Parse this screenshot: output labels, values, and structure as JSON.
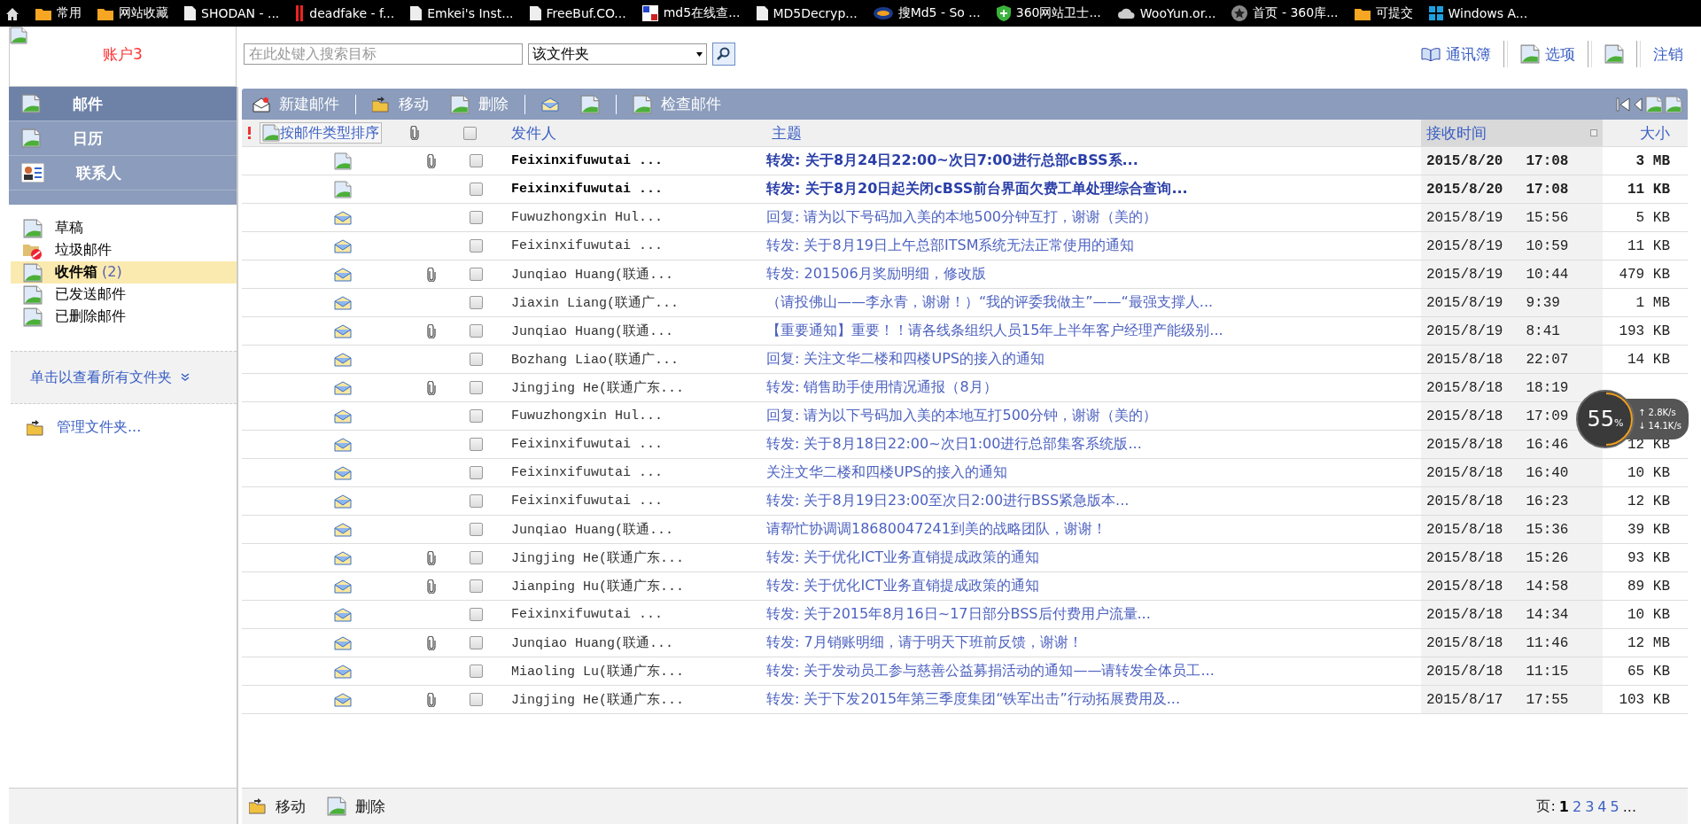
{
  "bookmarks": [
    {
      "kind": "home"
    },
    {
      "label": "常用",
      "kind": "folder"
    },
    {
      "label": "网站收藏",
      "kind": "folder"
    },
    {
      "label": "SHODAN - ...",
      "kind": "page"
    },
    {
      "label": "deadfake - f...",
      "kind": "bars"
    },
    {
      "label": "Emkei's Inst...",
      "kind": "page"
    },
    {
      "label": "FreeBuf.CO...",
      "kind": "page"
    },
    {
      "label": "md5在线查...",
      "kind": "grid"
    },
    {
      "label": "MD5Decryp...",
      "kind": "page"
    },
    {
      "label": "搜Md5 - So ...",
      "kind": "badge"
    },
    {
      "label": "360网站卫士...",
      "kind": "shield"
    },
    {
      "label": "WooYun.or...",
      "kind": "cloud"
    },
    {
      "label": "首页 - 360库...",
      "kind": "star"
    },
    {
      "label": "可提交",
      "kind": "folder"
    },
    {
      "label": "Windows A...",
      "kind": "windows"
    }
  ],
  "account": {
    "name": "账户3"
  },
  "search": {
    "placeholder": "在此处键入搜索目标",
    "scope": "该文件夹"
  },
  "top_links": [
    {
      "label": "通讯簿",
      "kind": "book"
    },
    {
      "label": "选项",
      "kind": "image"
    },
    {
      "kind": "image"
    },
    {
      "label": "注销",
      "kind": "none"
    }
  ],
  "nav": [
    {
      "label": "邮件",
      "selected": true,
      "kind": "image"
    },
    {
      "label": "日历",
      "selected": false,
      "kind": "image"
    },
    {
      "label": "联系人",
      "selected": false,
      "kind": "contact"
    }
  ],
  "folders": [
    {
      "label": "草稿",
      "selected": false,
      "kind": "image"
    },
    {
      "label": "垃圾邮件",
      "selected": false,
      "kind": "junk"
    },
    {
      "label": "收件箱",
      "count": "(2)",
      "selected": true,
      "kind": "image"
    },
    {
      "label": "已发送邮件",
      "selected": false,
      "kind": "image"
    },
    {
      "label": "已删除邮件",
      "selected": false,
      "kind": "image"
    }
  ],
  "all_folders_link": "单击以查看所有文件夹",
  "manage_folders": "管理文件夹...",
  "toolbar": [
    {
      "label": "新建邮件",
      "kind": "new"
    },
    {
      "label": "移动",
      "kind": "move"
    },
    {
      "label": "删除",
      "kind": "image"
    },
    {
      "kind": "envelope"
    },
    {
      "kind": "image"
    },
    {
      "label": "检查邮件",
      "kind": "image"
    }
  ],
  "columns": {
    "select_all_checked": false,
    "sort_by_type": "按邮件类型排序",
    "sender": "发件人",
    "subject": "主题",
    "received": "接收时间",
    "size": "大小"
  },
  "messages": [
    {
      "unread": true,
      "attachment": true,
      "checked": false,
      "sender": "Feixinxifuwutai ...",
      "subject": "转发: 关于8月24日22:00~次日7:00进行总部cBSS系...",
      "date": "2015/8/20",
      "time": "17:08",
      "size": "3 MB"
    },
    {
      "unread": true,
      "attachment": false,
      "checked": false,
      "sender": "Feixinxifuwutai ...",
      "subject": "转发: 关于8月20日起关闭cBSS前台界面欠费工单处理综合查询...",
      "date": "2015/8/20",
      "time": "17:08",
      "size": "11 KB"
    },
    {
      "unread": false,
      "attachment": false,
      "checked": false,
      "sender": "Fuwuzhongxin Hul...",
      "subject": "回复: 请为以下号码加入美的本地500分钟互打，谢谢（美的）",
      "date": "2015/8/19",
      "time": "15:56",
      "size": "5 KB"
    },
    {
      "unread": false,
      "attachment": false,
      "checked": false,
      "sender": "Feixinxifuwutai ...",
      "subject": "转发: 关于8月19日上午总部ITSM系统无法正常使用的通知",
      "date": "2015/8/19",
      "time": "10:59",
      "size": "11 KB"
    },
    {
      "unread": false,
      "attachment": true,
      "checked": false,
      "sender": "Junqiao Huang(联通...",
      "subject": "转发: 201506月奖励明细，修改版",
      "date": "2015/8/19",
      "time": "10:44",
      "size": "479 KB"
    },
    {
      "unread": false,
      "attachment": false,
      "checked": false,
      "sender": "Jiaxin Liang(联通广...",
      "subject": "（请投佛山——李永青，谢谢！）“我的评委我做主”——“最强支撑人...",
      "date": "2015/8/19",
      "time": "9:39",
      "size": "1 MB"
    },
    {
      "unread": false,
      "attachment": true,
      "checked": false,
      "sender": "Junqiao Huang(联通...",
      "subject": "【重要通知】重要！！请各线条组织人员15年上半年客户经理产能级别...",
      "date": "2015/8/19",
      "time": "8:41",
      "size": "193 KB"
    },
    {
      "unread": false,
      "attachment": false,
      "checked": false,
      "sender": "Bozhang Liao(联通广...",
      "subject": "回复: 关注文华二楼和四楼UPS的接入的通知",
      "date": "2015/8/18",
      "time": "22:07",
      "size": "14 KB"
    },
    {
      "unread": false,
      "attachment": true,
      "checked": false,
      "sender": "Jingjing He(联通广东...",
      "subject": "转发: 销售助手使用情况通报（8月）",
      "date": "2015/8/18",
      "time": "18:19"
    },
    {
      "unread": false,
      "attachment": false,
      "checked": false,
      "sender": "Fuwuzhongxin Hul...",
      "subject": "回复: 请为以下号码加入美的本地互打500分钟，谢谢（美的）",
      "date": "2015/8/18",
      "time": "17:09"
    },
    {
      "unread": false,
      "attachment": false,
      "checked": false,
      "sender": "Feixinxifuwutai ...",
      "subject": "转发: 关于8月18日22:00~次日1:00进行总部集客系统版...",
      "date": "2015/8/18",
      "time": "16:46",
      "size": "12 KB"
    },
    {
      "unread": false,
      "attachment": false,
      "checked": false,
      "sender": "Feixinxifuwutai ...",
      "subject": "关注文华二楼和四楼UPS的接入的通知",
      "date": "2015/8/18",
      "time": "16:40",
      "size": "10 KB"
    },
    {
      "unread": false,
      "attachment": false,
      "checked": false,
      "sender": "Feixinxifuwutai ...",
      "subject": "转发: 关于8月19日23:00至次日2:00进行BSS紧急版本...",
      "date": "2015/8/18",
      "time": "16:23",
      "size": "12 KB"
    },
    {
      "unread": false,
      "attachment": false,
      "checked": false,
      "sender": "Junqiao Huang(联通...",
      "subject": "请帮忙协调调18680047241到美的战略团队，谢谢！",
      "date": "2015/8/18",
      "time": "15:36",
      "size": "39 KB"
    },
    {
      "unread": false,
      "attachment": true,
      "checked": false,
      "sender": "Jingjing He(联通广东...",
      "subject": "转发: 关于优化ICT业务直销提成政策的通知",
      "date": "2015/8/18",
      "time": "15:26",
      "size": "93 KB"
    },
    {
      "unread": false,
      "attachment": true,
      "checked": false,
      "sender": "Jianping Hu(联通广东...",
      "subject": "转发: 关于优化ICT业务直销提成政策的通知",
      "date": "2015/8/18",
      "time": "14:58",
      "size": "89 KB"
    },
    {
      "unread": false,
      "attachment": false,
      "checked": false,
      "sender": "Feixinxifuwutai ...",
      "subject": "转发: 关于2015年8月16日~17日部分BSS后付费用户流量...",
      "date": "2015/8/18",
      "time": "14:34",
      "size": "10 KB"
    },
    {
      "unread": false,
      "attachment": true,
      "checked": false,
      "sender": "Junqiao Huang(联通...",
      "subject": "转发: 7月销账明细，请于明天下班前反馈，谢谢！",
      "date": "2015/8/18",
      "time": "11:46",
      "size": "12 MB"
    },
    {
      "unread": false,
      "attachment": false,
      "checked": false,
      "sender": "Miaoling Lu(联通广东...",
      "subject": "转发: 关于发动员工参与慈善公益募捐活动的通知——请转发全体员工...",
      "date": "2015/8/18",
      "time": "11:15",
      "size": "65 KB"
    },
    {
      "unread": false,
      "attachment": true,
      "checked": false,
      "sender": "Jingjing He(联通广东...",
      "subject": "转发: 关于下发2015年第三季度集团“铁军出击”行动拓展费用及...",
      "date": "2015/8/17",
      "time": "17:55",
      "size": "103 KB"
    }
  ],
  "bottom_toolbar": [
    {
      "label": "移动",
      "kind": "move"
    },
    {
      "label": "删除",
      "kind": "image"
    }
  ],
  "pager": {
    "label": "页:",
    "pages": [
      {
        "label": "1",
        "selected": true
      },
      {
        "label": "2",
        "selected": false
      },
      {
        "label": "3",
        "selected": false
      },
      {
        "label": "4",
        "selected": false
      },
      {
        "label": "5",
        "selected": false
      }
    ],
    "more": "..."
  },
  "speed_widget": {
    "percent": "55",
    "unit": "%",
    "up_arrow": "↑",
    "up": "2.8K/s",
    "down_arrow": "↓",
    "down": "14.1K/s"
  }
}
